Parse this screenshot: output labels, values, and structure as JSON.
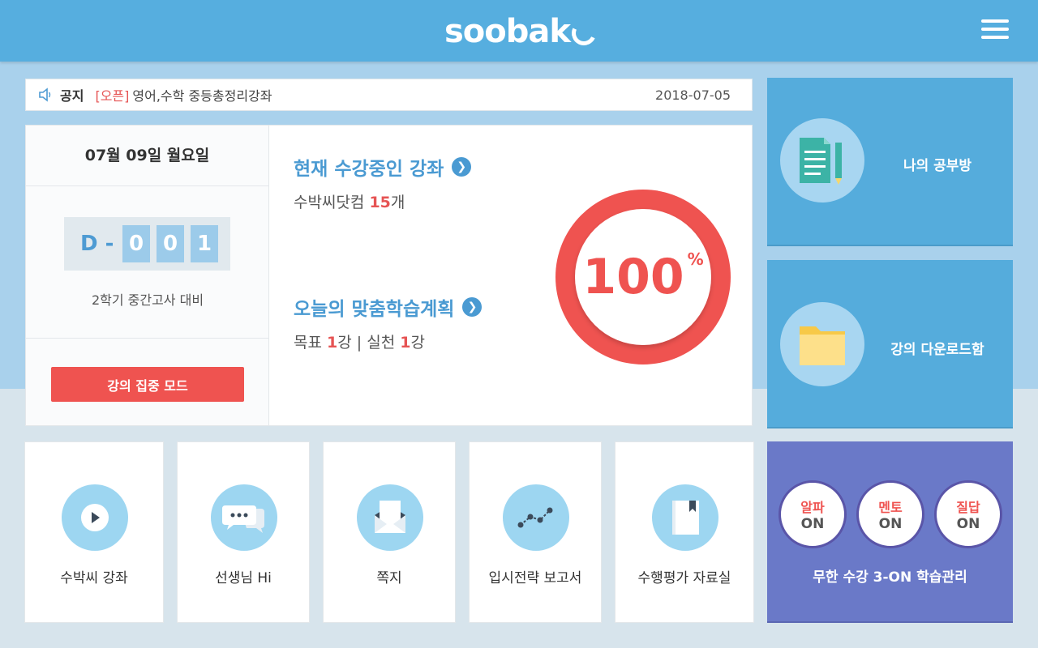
{
  "header": {
    "logo_text": "soobak",
    "menu_icon": "hamburger-menu-icon"
  },
  "notice": {
    "tag": "공지",
    "open_label": "[오픈]",
    "title": "영어,수학 중등총정리강좌",
    "date": "2018-07-05"
  },
  "today": {
    "date_label": "07월 09일 월요일",
    "dday_prefix": "D -",
    "dday_digits": [
      "0",
      "0",
      "1"
    ],
    "exam_label": "2학기 중간고사 대비",
    "focus_button": "강의 집중 모드"
  },
  "courses": {
    "title": "현재 수강중인 강좌",
    "site": "수박씨닷컴",
    "count": "15",
    "count_unit": "개"
  },
  "plan": {
    "title": "오늘의 맞춤학습계획",
    "goal_label": "목표",
    "goal_value": "1",
    "goal_unit": "강",
    "separator": "|",
    "done_label": "실천",
    "done_value": "1",
    "done_unit": "강"
  },
  "progress": {
    "value": "100",
    "unit": "%",
    "fraction": 1.0
  },
  "side_tiles": [
    {
      "label": "나의 공부방",
      "icon": "document-pencil-icon"
    },
    {
      "label": "강의 다운로드함",
      "icon": "folder-icon"
    }
  ],
  "bottom_tiles": [
    {
      "label": "수박씨 강좌",
      "icon": "play-icon"
    },
    {
      "label": "선생님 Hi",
      "icon": "chat-bubbles-icon"
    },
    {
      "label": "쪽지",
      "icon": "envelope-icon"
    },
    {
      "label": "입시전략 보고서",
      "icon": "line-graph-icon"
    },
    {
      "label": "수행평가 자료실",
      "icon": "book-icon"
    }
  ],
  "on_tile": {
    "items": [
      {
        "top": "알파",
        "bottom": "ON"
      },
      {
        "top": "멘토",
        "bottom": "ON"
      },
      {
        "top": "질답",
        "bottom": "ON"
      }
    ],
    "caption": "무한 수강 3-ON 학습관리"
  },
  "colors": {
    "header": "#56aedf",
    "accent_red": "#ef5350",
    "title_blue": "#4a9ad2",
    "on_tile": "#6a79c8"
  }
}
